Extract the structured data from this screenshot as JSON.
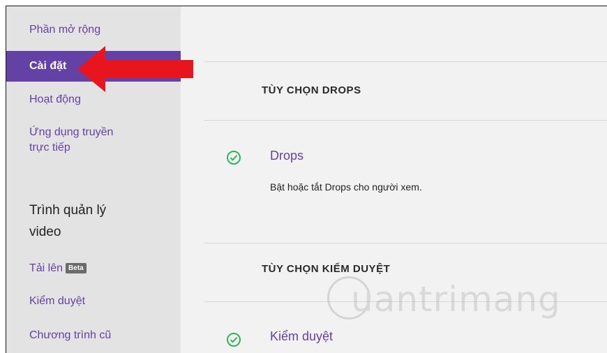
{
  "sidebar": {
    "items": [
      {
        "label": "Phần mở rộng"
      },
      {
        "label": "Cài đặt",
        "active": true
      },
      {
        "label": "Hoạt động"
      },
      {
        "label_line1": "Ứng dụng truyền",
        "label_line2": "trực tiếp"
      }
    ],
    "section_heading_line1": "Trình quản lý",
    "section_heading_line2": "video",
    "video_items": [
      {
        "label": "Tải lên",
        "badge": "Beta"
      },
      {
        "label": "Kiểm duyệt"
      },
      {
        "label": "Chương trình cũ"
      }
    ]
  },
  "main": {
    "drops_section": {
      "title": "TÙY CHỌN DROPS",
      "option": {
        "title": "Drops",
        "description": "Bật hoặc tắt Drops cho người xem.",
        "enabled": true
      }
    },
    "moderation_section": {
      "title": "TÙY CHỌN KIỂM DUYỆT",
      "option": {
        "title": "Kiểm duyệt",
        "enabled": true
      }
    }
  },
  "watermark": {
    "text": "uantrimang"
  },
  "colors": {
    "accent": "#6441a4",
    "check": "#2fb45a",
    "arrow": "#e8141e"
  }
}
